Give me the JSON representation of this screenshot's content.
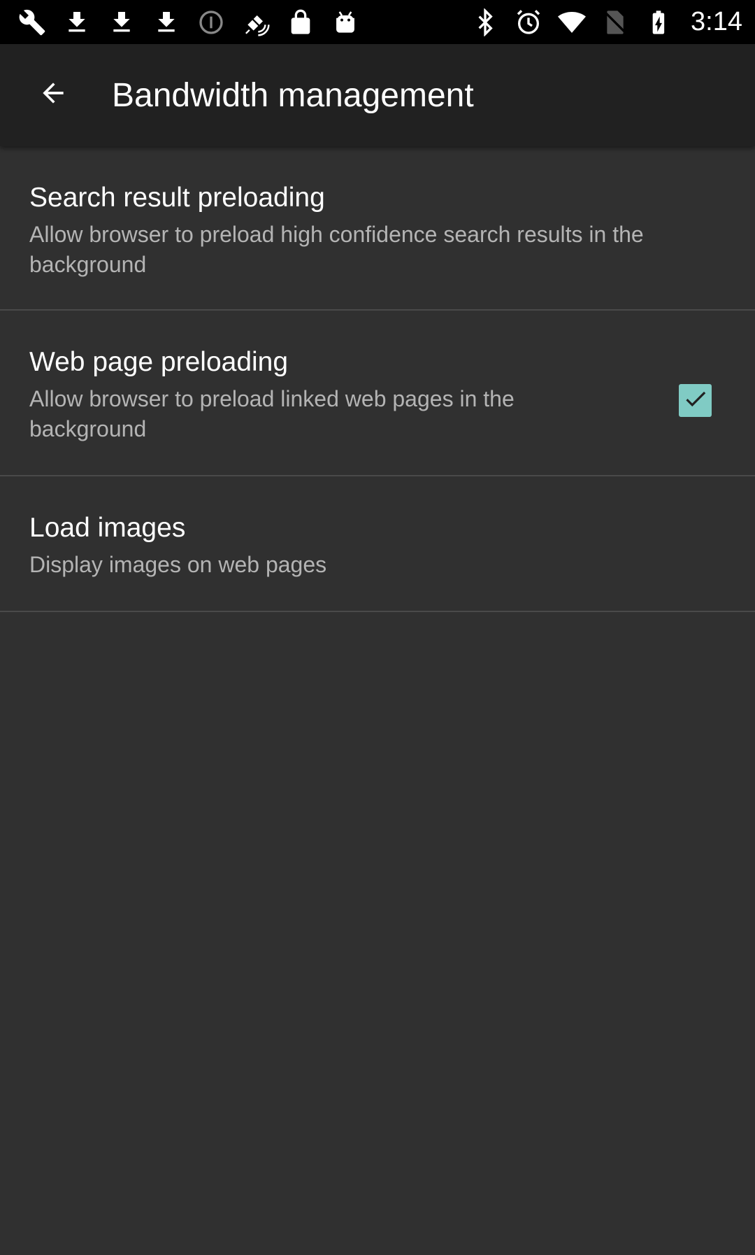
{
  "status_bar": {
    "icons_left": [
      "wrench-icon",
      "download-icon",
      "download-icon",
      "download-icon",
      "info-icon",
      "satellite-icon",
      "lock-icon",
      "android-icon"
    ],
    "icons_right": [
      "bluetooth-icon",
      "alarm-icon",
      "wifi-icon",
      "no-sim-icon",
      "battery-charging-icon"
    ],
    "time": "3:14"
  },
  "app_bar": {
    "back_icon": "arrow-back-icon",
    "title": "Bandwidth management"
  },
  "settings": [
    {
      "title": "Search result preloading",
      "summary": "Allow browser to preload high confidence search results in the background"
    },
    {
      "title": "Web page preloading",
      "summary": "Allow browser to preload linked web pages in the background"
    },
    {
      "title": "Load images",
      "summary": "Display images on web pages",
      "checked": true
    }
  ],
  "colors": {
    "background": "#303030",
    "app_bar": "#212121",
    "accent": "#80cbc4",
    "summary_text": "#b4b4b4",
    "divider": "#4a4a4a"
  }
}
